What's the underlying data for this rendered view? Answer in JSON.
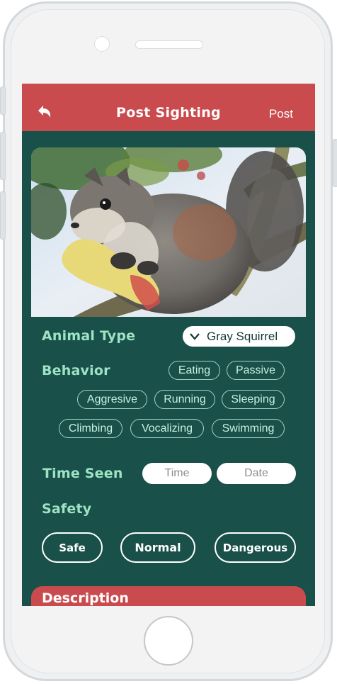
{
  "header": {
    "title": "Post Sighting",
    "post_label": "Post",
    "back_icon": "back-arrow-icon"
  },
  "photo": {
    "subject": "gray squirrel eating an apple core on a tree branch"
  },
  "animal_type": {
    "label": "Animal Type",
    "selected": "Gray Squirrel",
    "icon": "chevron-down-icon"
  },
  "behavior": {
    "label": "Behavior",
    "options": [
      "Eating",
      "Passive",
      "Aggresive",
      "Running",
      "Sleeping",
      "Climbing",
      "Vocalizing",
      "Swimming"
    ]
  },
  "time_seen": {
    "label": "Time Seen",
    "time_placeholder": "Time",
    "date_placeholder": "Date"
  },
  "safety": {
    "label": "Safety",
    "options": [
      "Safe",
      "Normal",
      "Dangerous"
    ]
  },
  "description": {
    "title": "Description"
  },
  "colors": {
    "header_red": "#c94b4e",
    "screen_green": "#19504a",
    "label_mint": "#9ee3c3"
  }
}
